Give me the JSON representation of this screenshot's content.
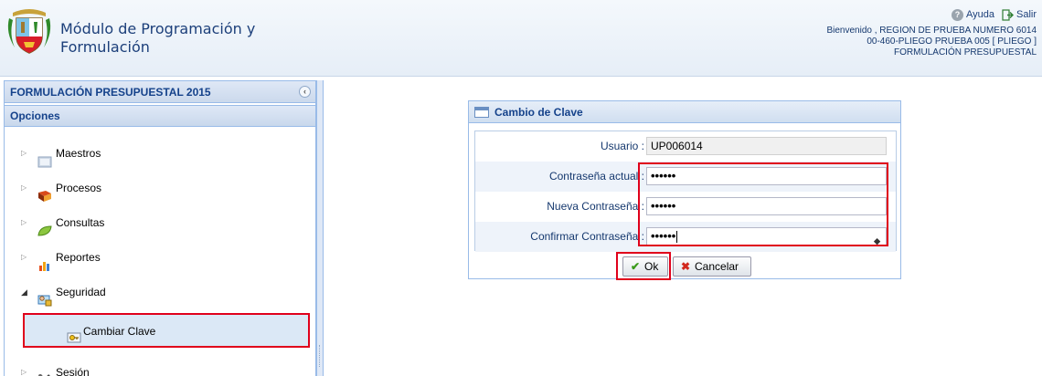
{
  "header": {
    "app_title": "Módulo de Programación y Formulación",
    "help_label": "Ayuda",
    "exit_label": "Salir",
    "welcome_lines": [
      "Bienvenido , REGION DE PRUEBA NUMERO 6014",
      "00-460-PLIEGO PRUEBA 005 [ PLIEGO ]",
      "FORMULACIÓN PRESUPUESTAL"
    ]
  },
  "left_panel": {
    "title": "FORMULACIÓN PRESUPUESTAL 2015",
    "options_title": "Opciones",
    "items": [
      {
        "label": "Maestros",
        "arrow": "▷",
        "icon": "folder-icon"
      },
      {
        "label": "Procesos",
        "arrow": "▷",
        "icon": "book-icon"
      },
      {
        "label": "Consultas",
        "arrow": "▷",
        "icon": "leaf-icon"
      },
      {
        "label": "Reportes",
        "arrow": "▷",
        "icon": "chart-icon"
      },
      {
        "label": "Seguridad",
        "arrow": "◢",
        "icon": "security-icon"
      },
      {
        "label": "Sesión",
        "arrow": "▷",
        "icon": "tools-icon"
      }
    ],
    "child_item": {
      "label": "Cambiar Clave",
      "icon": "key-icon"
    }
  },
  "dialog": {
    "title": "Cambio de Clave",
    "fields": [
      {
        "label": "Usuario :",
        "value": "UP006014"
      },
      {
        "label": "Contraseña actual :",
        "value": "••••••"
      },
      {
        "label": "Nueva Contraseña :",
        "value": "••••••"
      },
      {
        "label": "Confirmar Contraseña :",
        "value": "••••••"
      }
    ],
    "ok_label": "Ok",
    "cancel_label": "Cancelar"
  },
  "colors": {
    "highlight": "#e0001b",
    "panel_border": "#99bbe8",
    "title_text": "#15428b"
  }
}
